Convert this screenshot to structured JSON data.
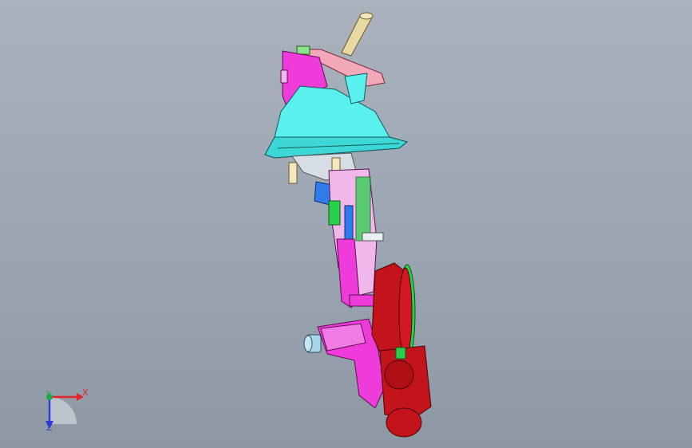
{
  "viewport": {
    "background_top": "#a9b2bd",
    "background_bottom": "#8e98a4"
  },
  "model": {
    "part_colors": {
      "shaft": "#e8d9a2",
      "bracket": "#f2a8b8",
      "housing": "#59f0ee",
      "body": "#ef3bd9",
      "lever": "#2f7bea",
      "frame": "#27d14a",
      "motor": "#c3141c",
      "fitting": "#a9d6e6"
    }
  },
  "triad": {
    "x_label": "X",
    "y_label": "Y",
    "z_label": "Z",
    "x_color": "#e0252b",
    "y_color": "#1fa84a",
    "z_color": "#2b3fd4"
  }
}
